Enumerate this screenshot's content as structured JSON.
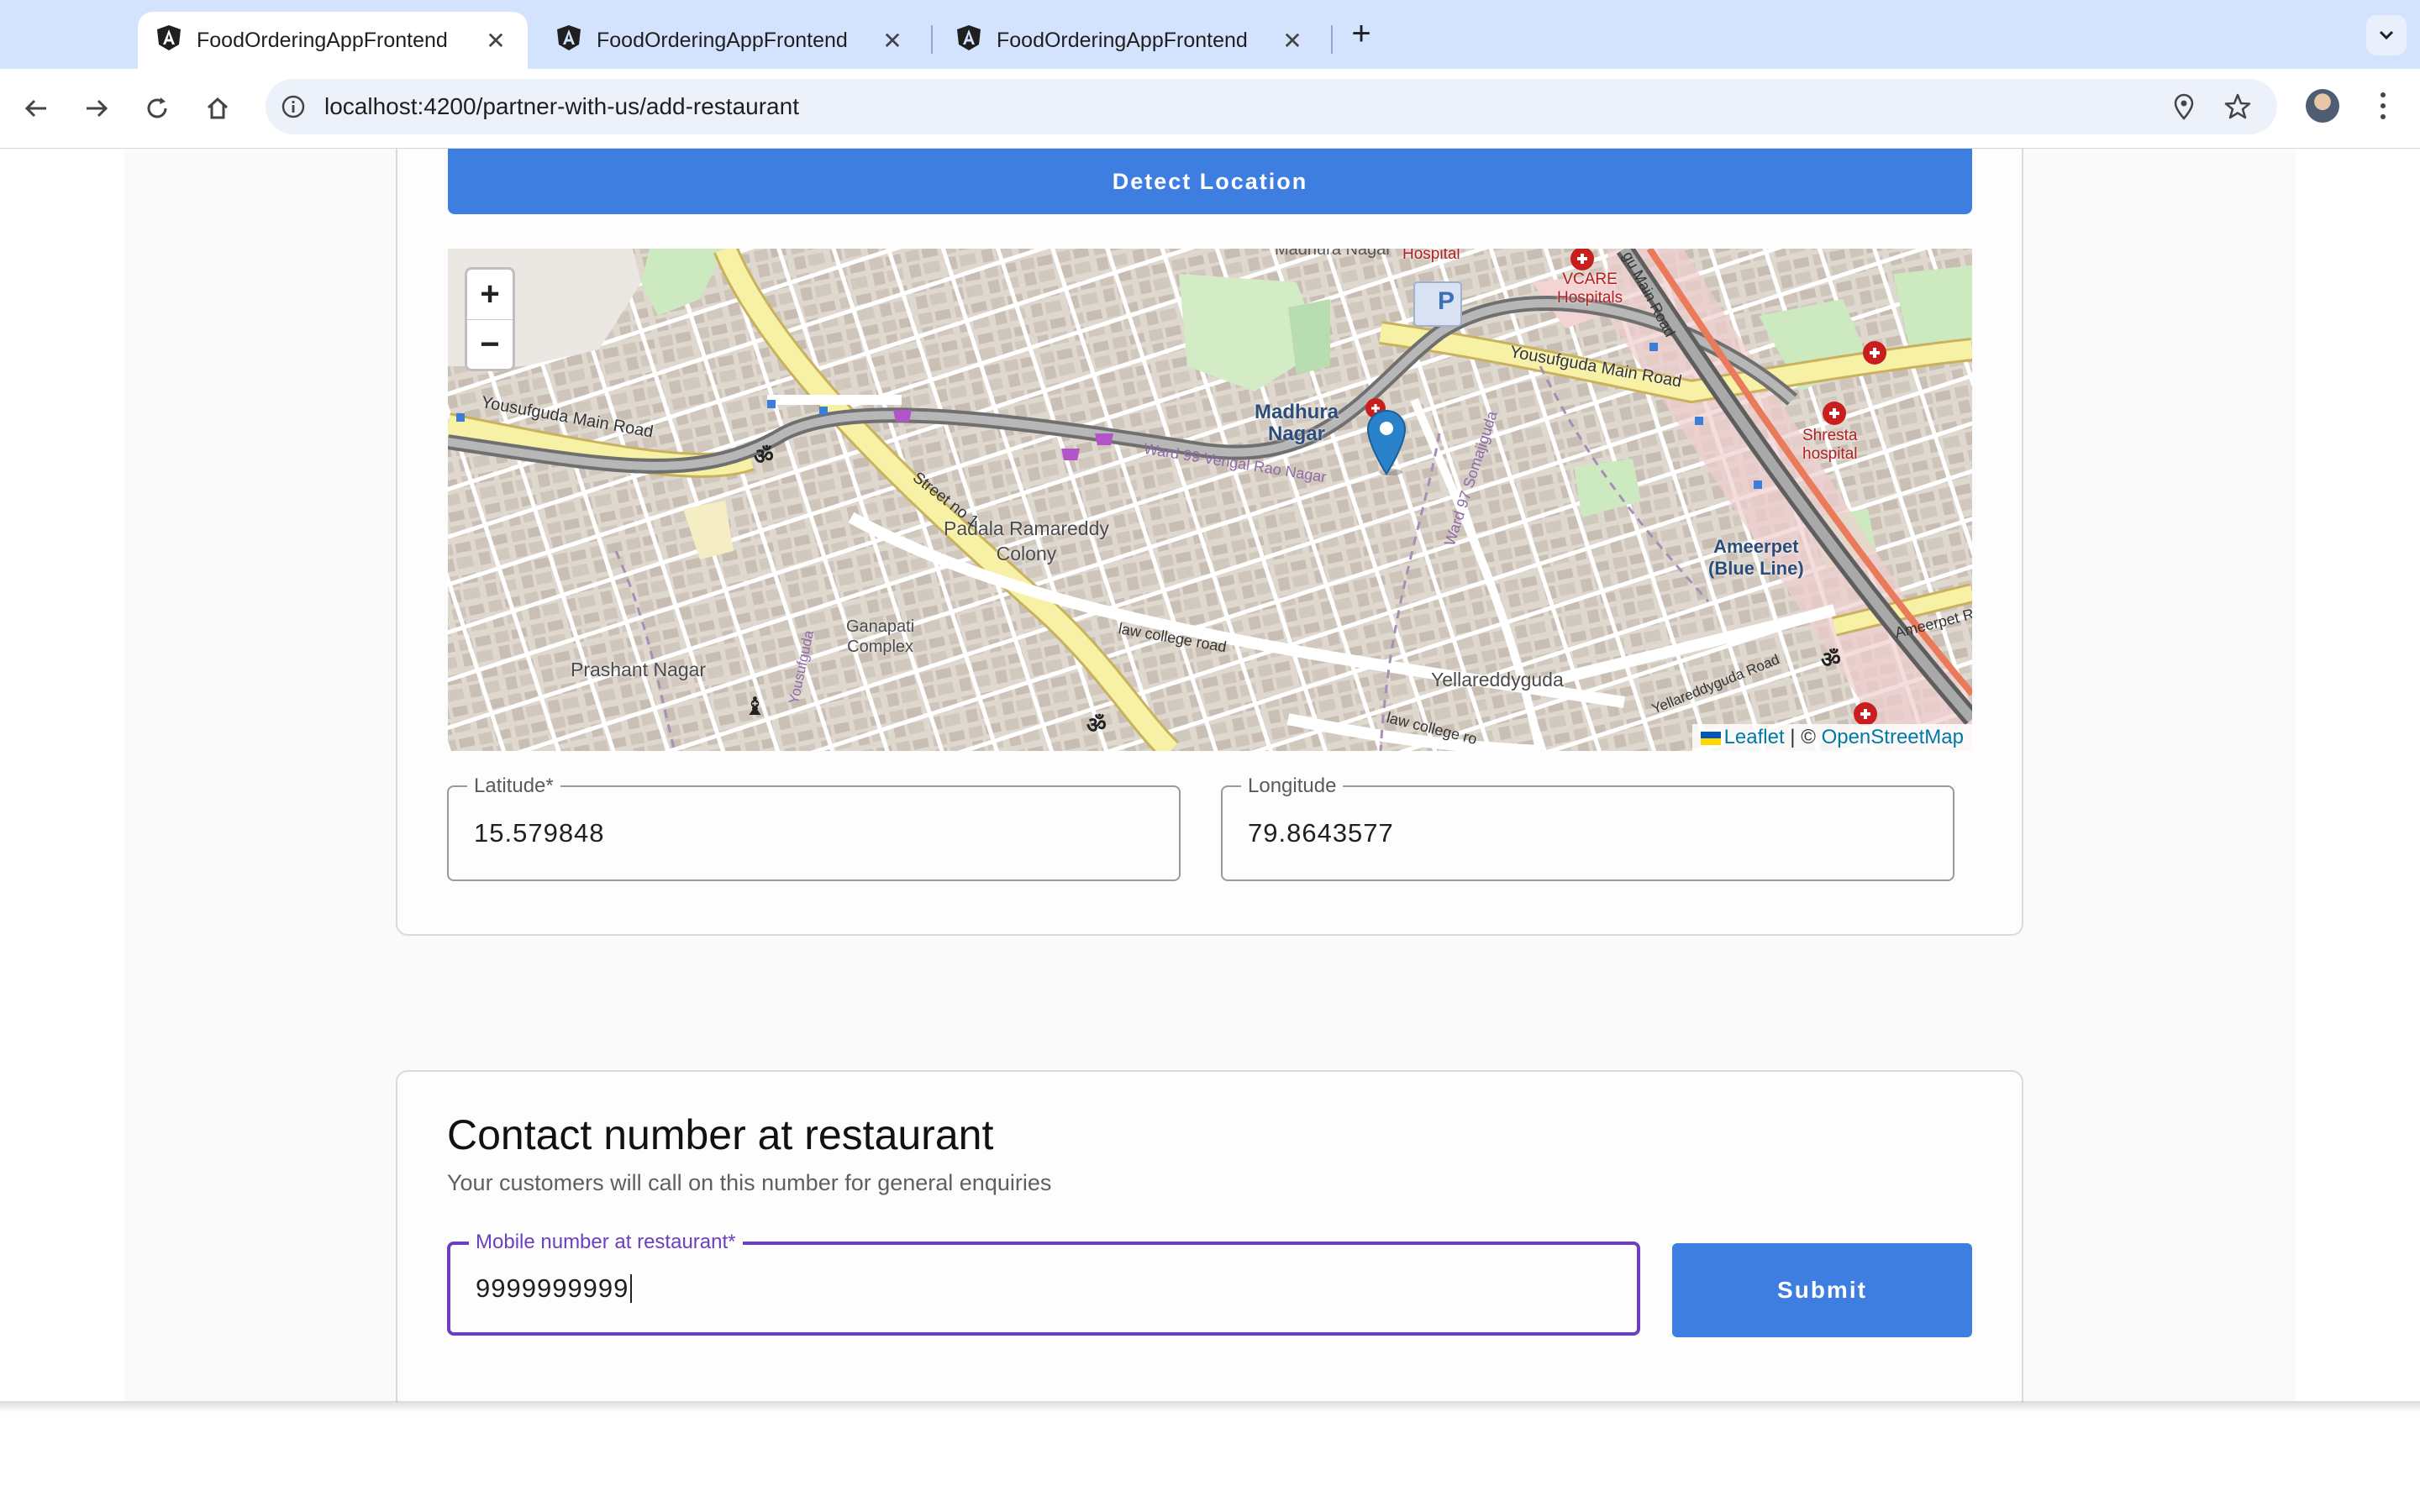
{
  "browser": {
    "tabs": [
      {
        "title": "FoodOrderingAppFrontend",
        "active": true
      },
      {
        "title": "FoodOrderingAppFrontend",
        "active": false
      },
      {
        "title": "FoodOrderingAppFrontend",
        "active": false
      }
    ],
    "url": "localhost:4200/partner-with-us/add-restaurant"
  },
  "location": {
    "detect_button_label": "Detect Location",
    "map": {
      "zoom_in_label": "+",
      "zoom_out_label": "−",
      "attribution": {
        "leaflet": "Leaflet",
        "separator": "| ©",
        "osm": "OpenStreetMap"
      },
      "labels": {
        "madhura_nagar_1": "Madhura",
        "madhura_nagar_2": "Nagar",
        "yousufguda_road_left": "Yousufguda Main Road",
        "yousufguda_road_right": "Yousufguda Main Road",
        "padala_1": "Padala Ramareddy",
        "padala_2": "Colony",
        "ganapati_1": "Ganapati",
        "ganapati_2": "Complex",
        "prashant": "Prashant Nagar",
        "yellareddyguda": "Yellareddyguda",
        "ameerpet_1": "Ameerpet",
        "ameerpet_2": "(Blue Line)",
        "vcare_1": "VCARE",
        "vcare_2": "Hospitals",
        "shresta_1": "Shresta",
        "shresta_2": "hospital",
        "hospital_top": "Hospital",
        "street_no1": "Street no 1",
        "law_college": "law college road",
        "law_college_2": "law college ro",
        "yellareddyguda_road": "Yellareddyguda Road",
        "ameerpet_road": "Ameerpet R",
        "ward_vengal": "Ward 99 Vengal Rao Nagar",
        "ward97": "Ward 97 Somajiguda",
        "main_road_top": "gu Main Road",
        "yousufguda_side": "Yousufguda",
        "madhura_top": "Madhura Nagar",
        "parking": "P"
      }
    },
    "latitude": {
      "label": "Latitude*",
      "value": "15.579848"
    },
    "longitude": {
      "label": "Longitude",
      "value": "79.8643577"
    }
  },
  "contact": {
    "title": "Contact number at restaurant",
    "subtitle": "Your customers will call on this number for general enquiries",
    "mobile": {
      "label": "Mobile number at restaurant*",
      "value": "9999999999"
    },
    "submit_label": "Submit"
  }
}
